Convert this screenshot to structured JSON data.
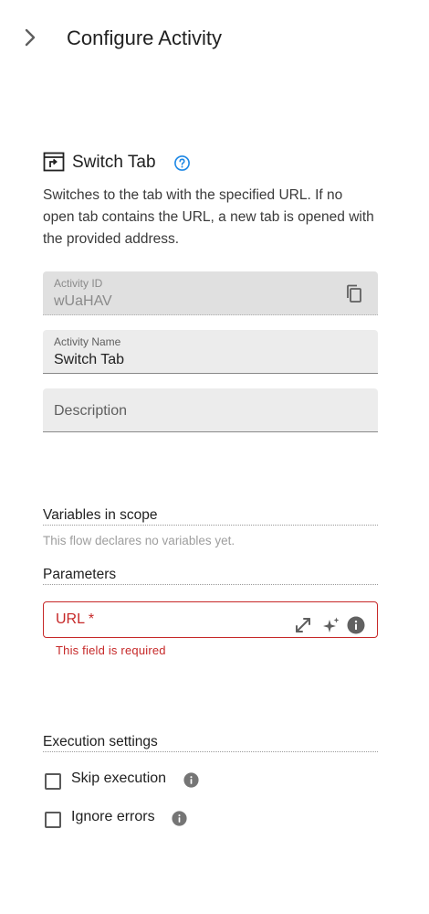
{
  "header": {
    "title": "Configure Activity"
  },
  "activity": {
    "title": "Switch Tab",
    "description": "Switches to the tab with the specified URL. If no open tab contains the URL, a new tab is opened with the provided address."
  },
  "fields": {
    "activity_id": {
      "label": "Activity ID",
      "value": "wUaHAV"
    },
    "activity_name": {
      "label": "Activity Name",
      "value": "Switch Tab"
    },
    "description": {
      "placeholder": "Description"
    }
  },
  "variables": {
    "title": "Variables in scope",
    "empty_text": "This flow declares no variables yet."
  },
  "parameters": {
    "title": "Parameters",
    "url": {
      "label": "URL *",
      "error": "This field is required"
    }
  },
  "execution": {
    "title": "Execution settings",
    "skip_label": "Skip execution",
    "ignore_label": "Ignore errors"
  },
  "icons": [
    "chevron-right-icon",
    "switch-tab-icon",
    "help-icon",
    "copy-icon",
    "expand-icon",
    "sparkles-icon",
    "info-icon"
  ],
  "colors": {
    "error": "#c62828",
    "help": "#1e88e5",
    "field_bg": "#ececec"
  }
}
